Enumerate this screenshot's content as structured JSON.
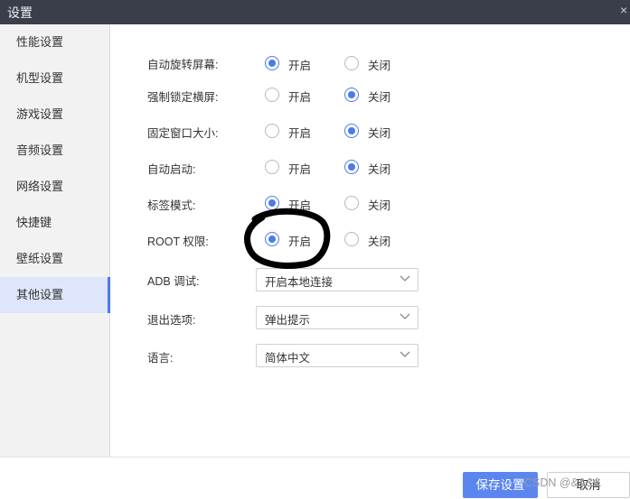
{
  "window": {
    "title": "设置",
    "close_glyph": "×"
  },
  "sidebar": {
    "items": [
      {
        "label": "性能设置"
      },
      {
        "label": "机型设置"
      },
      {
        "label": "游戏设置"
      },
      {
        "label": "音频设置"
      },
      {
        "label": "网络设置"
      },
      {
        "label": "快捷键"
      },
      {
        "label": "壁纸设置"
      },
      {
        "label": "其他设置",
        "active": true
      }
    ]
  },
  "settings": {
    "on_label": "开启",
    "off_label": "关闭",
    "rows": [
      {
        "label": "自动旋转屏幕:",
        "value": "on"
      },
      {
        "label": "强制锁定横屏:",
        "value": "off"
      },
      {
        "label": "固定窗口大小:",
        "value": "off"
      },
      {
        "label": "自动启动:",
        "value": "off"
      },
      {
        "label": "标签模式:",
        "value": "on"
      },
      {
        "label": "ROOT 权限:",
        "value": "on"
      }
    ],
    "selects": [
      {
        "label": "ADB 调试:",
        "value": "开启本地连接"
      },
      {
        "label": "退出选项:",
        "value": "弹出提示"
      },
      {
        "label": "语言:",
        "value": "简体中文"
      }
    ]
  },
  "footer": {
    "save_label": "保存设置",
    "cancel_label": "取消",
    "watermark": "CSDN @&&&&"
  },
  "colors": {
    "accent": "#4a79f0",
    "titlebar": "#3a3d4a",
    "sidebar_bg": "#f2f2f2",
    "active_bg": "#dfe6fb"
  },
  "icons": {
    "close": "close-icon",
    "dropdown": "chevron-down-icon"
  }
}
